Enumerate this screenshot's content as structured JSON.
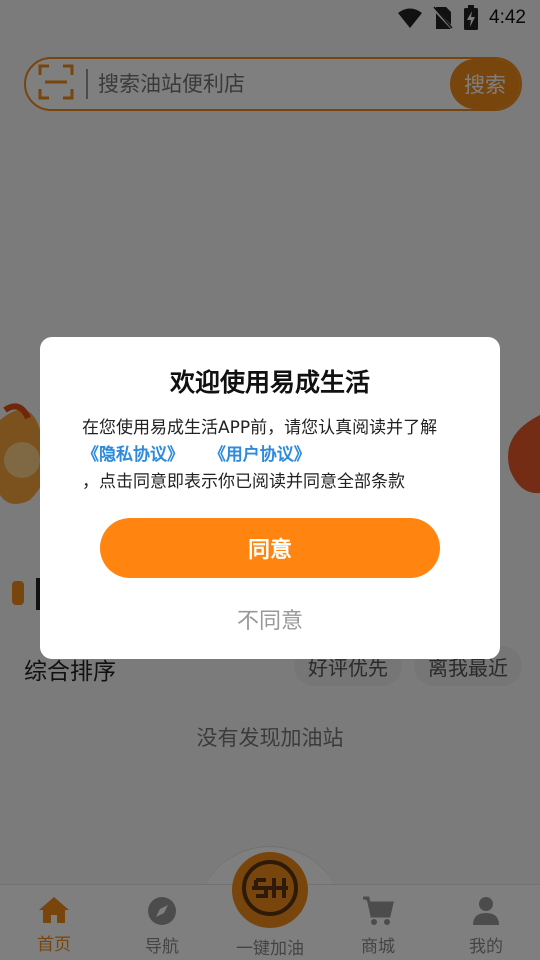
{
  "status_bar": {
    "time": "4:42"
  },
  "search": {
    "placeholder": "搜索油站便利店",
    "button_label": "搜索"
  },
  "sort": {
    "title": "综合排序",
    "chip_good": "好评优先",
    "chip_near": "离我最近"
  },
  "empty_message": "没有发现加油站",
  "bottom_nav": {
    "items": [
      {
        "label": "首页",
        "icon": "home-icon"
      },
      {
        "label": "导航",
        "icon": "compass-icon"
      },
      {
        "label": "一键加油",
        "icon": "fuel-logo-icon"
      },
      {
        "label": "商城",
        "icon": "cart-icon"
      },
      {
        "label": "我的",
        "icon": "person-icon"
      }
    ]
  },
  "dialog": {
    "title": "欢迎使用易成生活",
    "intro": "在您使用易成生活APP前，请您认真阅读并了解",
    "privacy_link": "《隐私协议》",
    "user_link": "《用户协议》",
    "outro": "，点击同意即表示你已阅读并同意全部条款",
    "agree_label": "同意",
    "disagree_label": "不同意"
  },
  "colors": {
    "accent": "#f08a1a",
    "link": "#2e8bdc",
    "agree": "#ff8410"
  }
}
